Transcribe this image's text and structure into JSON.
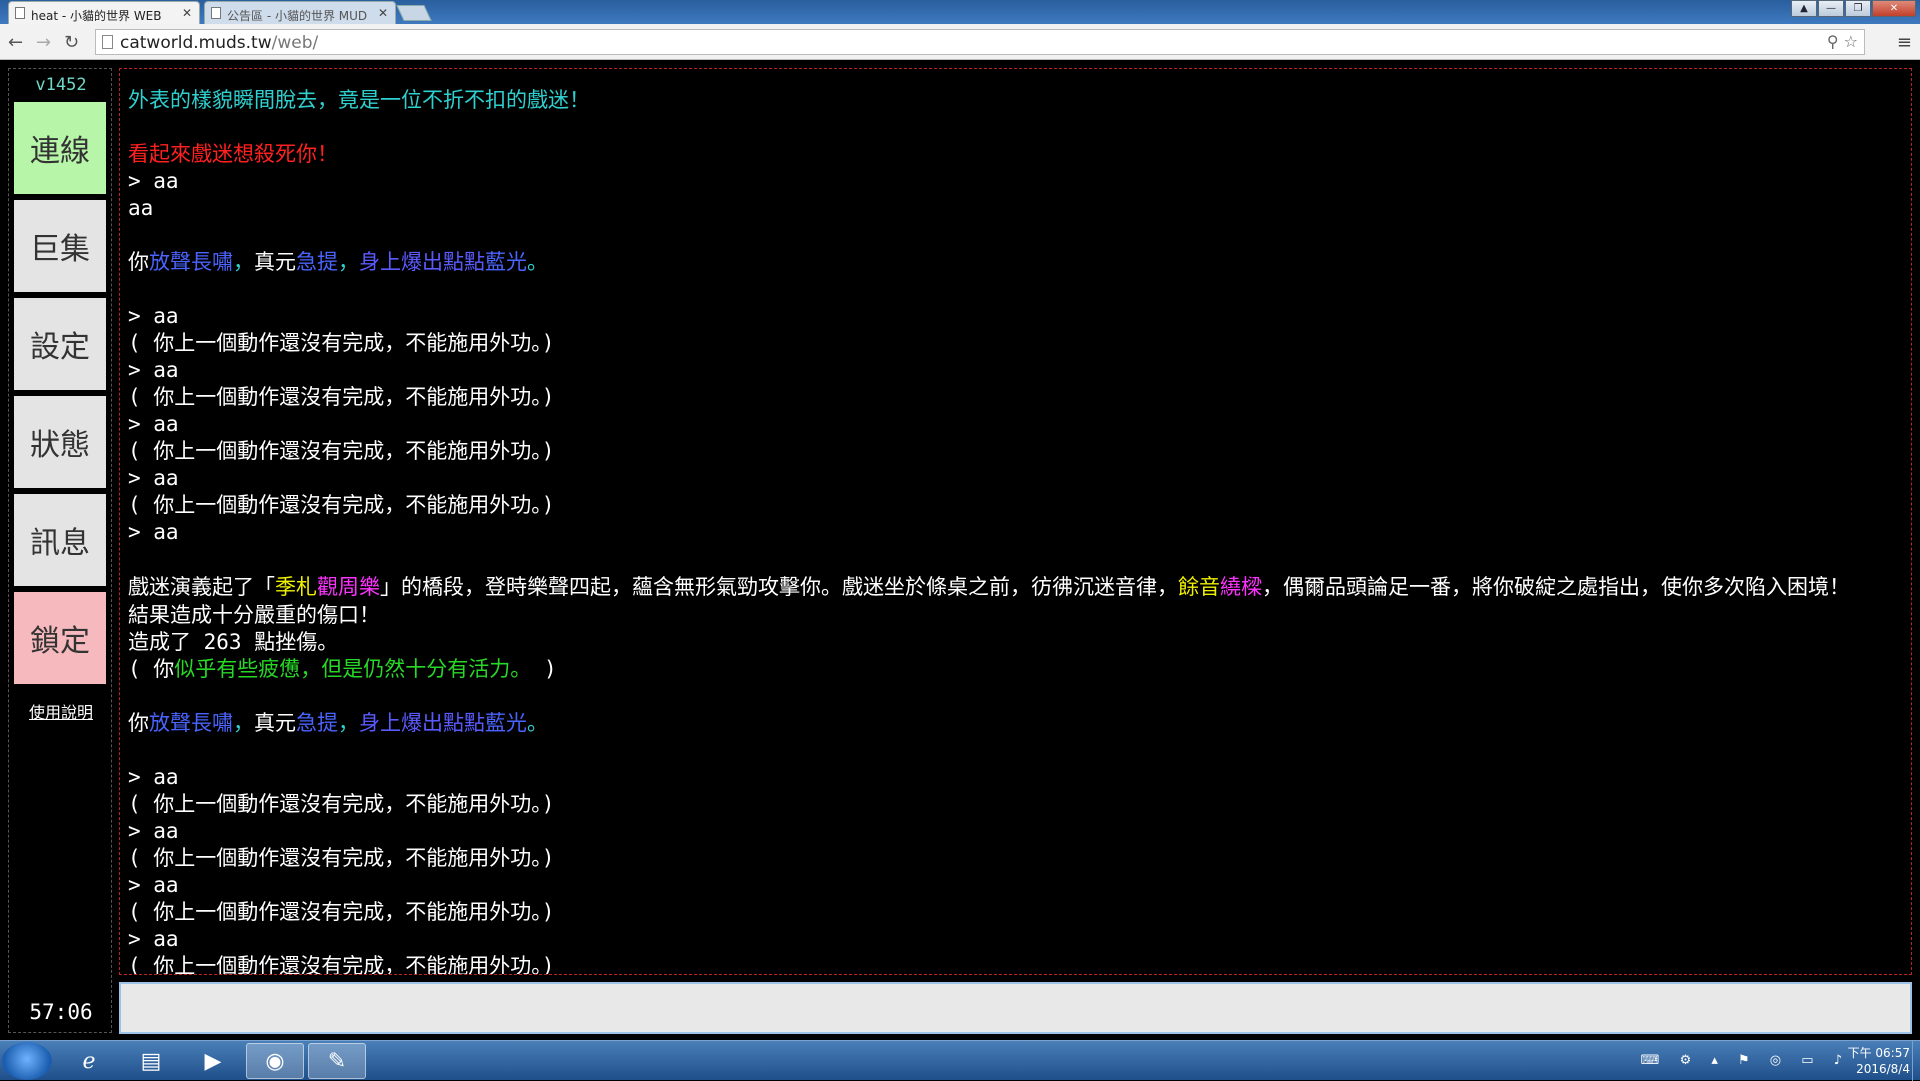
{
  "browser": {
    "tabs": [
      {
        "label": "heat - 小貓的世界 WEB",
        "active": true
      },
      {
        "label": "公告區 - 小貓的世界 MUD",
        "active": false
      }
    ],
    "url_host": "catworld.muds.tw",
    "url_path": "/web/"
  },
  "sidebar": {
    "version": "v1452",
    "buttons": [
      {
        "label": "連線",
        "color": "green"
      },
      {
        "label": "巨集",
        "color": "gray"
      },
      {
        "label": "設定",
        "color": "gray"
      },
      {
        "label": "狀態",
        "color": "gray"
      },
      {
        "label": "訊息",
        "color": "gray"
      },
      {
        "label": "鎖定",
        "color": "pink"
      }
    ],
    "help_link": "使用說明",
    "timer": "57:06"
  },
  "output": {
    "lines": [
      {
        "segments": [
          {
            "text": "外表的樣貌瞬間脫去，竟是一位不折不扣的戲迷！",
            "color": "cyan"
          }
        ]
      },
      {
        "segments": []
      },
      {
        "segments": [
          {
            "text": "看起來戲迷想殺死你！",
            "color": "red"
          }
        ]
      },
      {
        "segments": [
          {
            "text": "> aa"
          }
        ]
      },
      {
        "segments": [
          {
            "text": "aa"
          }
        ]
      },
      {
        "segments": []
      },
      {
        "segments": [
          {
            "text": "你"
          },
          {
            "text": "放聲長嘯",
            "color": "blue"
          },
          {
            "text": "，",
            "color": "cyan"
          },
          {
            "text": "真元"
          },
          {
            "text": "急提",
            "color": "blue"
          },
          {
            "text": "，",
            "color": "cyan"
          },
          {
            "text": "身上爆出點點",
            "color": "purple"
          },
          {
            "text": "藍光",
            "color": "blue"
          },
          {
            "text": "。",
            "color": "cyan"
          }
        ]
      },
      {
        "segments": []
      },
      {
        "segments": [
          {
            "text": "> aa"
          }
        ]
      },
      {
        "segments": [
          {
            "text": "( 你上一個動作還沒有完成，不能施用外功。)"
          }
        ]
      },
      {
        "segments": [
          {
            "text": "> aa"
          }
        ]
      },
      {
        "segments": [
          {
            "text": "( 你上一個動作還沒有完成，不能施用外功。)"
          }
        ]
      },
      {
        "segments": [
          {
            "text": "> aa"
          }
        ]
      },
      {
        "segments": [
          {
            "text": "( 你上一個動作還沒有完成，不能施用外功。)"
          }
        ]
      },
      {
        "segments": [
          {
            "text": "> aa"
          }
        ]
      },
      {
        "segments": [
          {
            "text": "( 你上一個動作還沒有完成，不能施用外功。)"
          }
        ]
      },
      {
        "segments": [
          {
            "text": "> aa"
          }
        ]
      },
      {
        "segments": []
      },
      {
        "wrap": true,
        "segments": [
          {
            "text": "戲迷演義起了「"
          },
          {
            "text": "季札",
            "color": "yellow"
          },
          {
            "text": "觀周樂",
            "color": "magenta"
          },
          {
            "text": "」的橋段，登時樂聲四起，蘊含無形氣勁攻擊你。戲迷坐於條桌之前，彷彿沉迷音律，"
          },
          {
            "text": "餘音",
            "color": "yellow"
          },
          {
            "text": "繞樑",
            "color": "magenta"
          },
          {
            "text": "，偶爾品頭論足一番，將你破綻之處指出，使你多次陷入困境！"
          }
        ]
      },
      {
        "segments": [
          {
            "text": "結果造成十分嚴重的傷口！"
          }
        ]
      },
      {
        "segments": [
          {
            "text": "造成了 263 點挫傷。"
          }
        ]
      },
      {
        "segments": [
          {
            "text": "( 你"
          },
          {
            "text": "似乎有些疲憊，但是仍然十分有活力。",
            "color": "green"
          },
          {
            "text": " )"
          }
        ]
      },
      {
        "segments": []
      },
      {
        "segments": [
          {
            "text": "你"
          },
          {
            "text": "放聲長嘯",
            "color": "blue"
          },
          {
            "text": "，",
            "color": "cyan"
          },
          {
            "text": "真元"
          },
          {
            "text": "急提",
            "color": "blue"
          },
          {
            "text": "，",
            "color": "cyan"
          },
          {
            "text": "身上爆出點點",
            "color": "purple"
          },
          {
            "text": "藍光",
            "color": "blue"
          },
          {
            "text": "。",
            "color": "cyan"
          }
        ]
      },
      {
        "segments": []
      },
      {
        "segments": [
          {
            "text": "> aa"
          }
        ]
      },
      {
        "segments": [
          {
            "text": "( 你上一個動作還沒有完成，不能施用外功。)"
          }
        ]
      },
      {
        "segments": [
          {
            "text": "> aa"
          }
        ]
      },
      {
        "segments": [
          {
            "text": "( 你上一個動作還沒有完成，不能施用外功。)"
          }
        ]
      },
      {
        "segments": [
          {
            "text": "> aa"
          }
        ]
      },
      {
        "segments": [
          {
            "text": "( 你上一個動作還沒有完成，不能施用外功。)"
          }
        ]
      },
      {
        "segments": [
          {
            "text": "> aa"
          }
        ]
      },
      {
        "segments": [
          {
            "text": "( 你上一個動作還沒有完成，不能施用外功。)"
          }
        ]
      }
    ]
  },
  "input": {
    "value": ""
  },
  "taskbar": {
    "clock_period": "下午 06:57",
    "clock_date": "2016/8/4"
  }
}
